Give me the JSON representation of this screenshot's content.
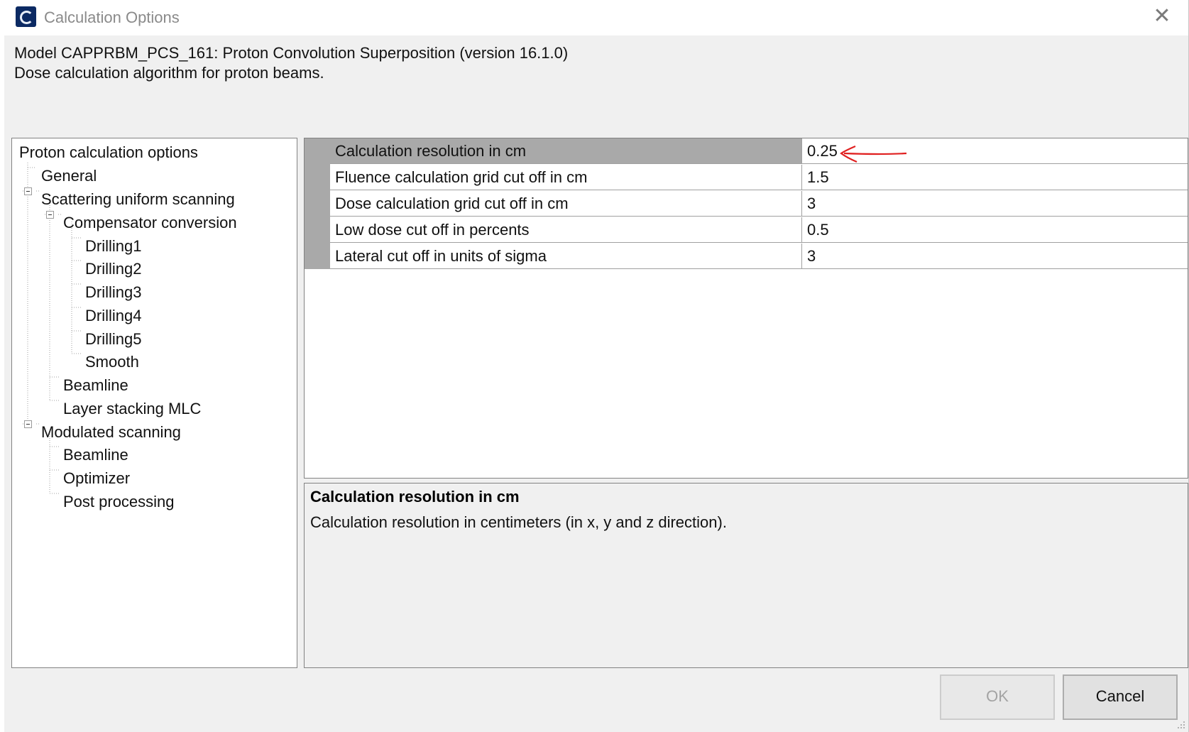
{
  "window": {
    "title": "Calculation Options",
    "close_glyph": "✕"
  },
  "header": {
    "model_line": "Model CAPPRBM_PCS_161: Proton Convolution Superposition (version 16.1.0)",
    "description_line": "Dose calculation algorithm for proton beams."
  },
  "tree": {
    "root": "Proton calculation options",
    "items": [
      "General",
      "Scattering uniform scanning",
      "Compensator conversion",
      "Drilling1",
      "Drilling2",
      "Drilling3",
      "Drilling4",
      "Drilling5",
      "Smooth",
      "Beamline",
      "Layer stacking MLC",
      "Modulated scanning",
      "Beamline",
      "Optimizer",
      "Post processing"
    ]
  },
  "grid": {
    "rows": [
      {
        "name": "Calculation resolution in cm",
        "value": "0.25"
      },
      {
        "name": "Fluence calculation grid cut off in cm",
        "value": "1.5"
      },
      {
        "name": "Dose calculation grid cut off in cm",
        "value": "3"
      },
      {
        "name": "Low dose cut off in percents",
        "value": "0.5"
      },
      {
        "name": "Lateral cut off in units of sigma",
        "value": "3"
      }
    ]
  },
  "description": {
    "title": "Calculation resolution in cm",
    "text": "Calculation resolution in centimeters (in x, y and z direction)."
  },
  "buttons": {
    "ok": "OK",
    "cancel": "Cancel"
  },
  "colors": {
    "annotation_arrow": "#e02020",
    "selected_row": "#a9a9a9",
    "app_icon": "#0c2a63"
  },
  "icons": {
    "app": "app-logo-icon",
    "close": "close-icon",
    "annotation": "red-arrow-icon"
  }
}
